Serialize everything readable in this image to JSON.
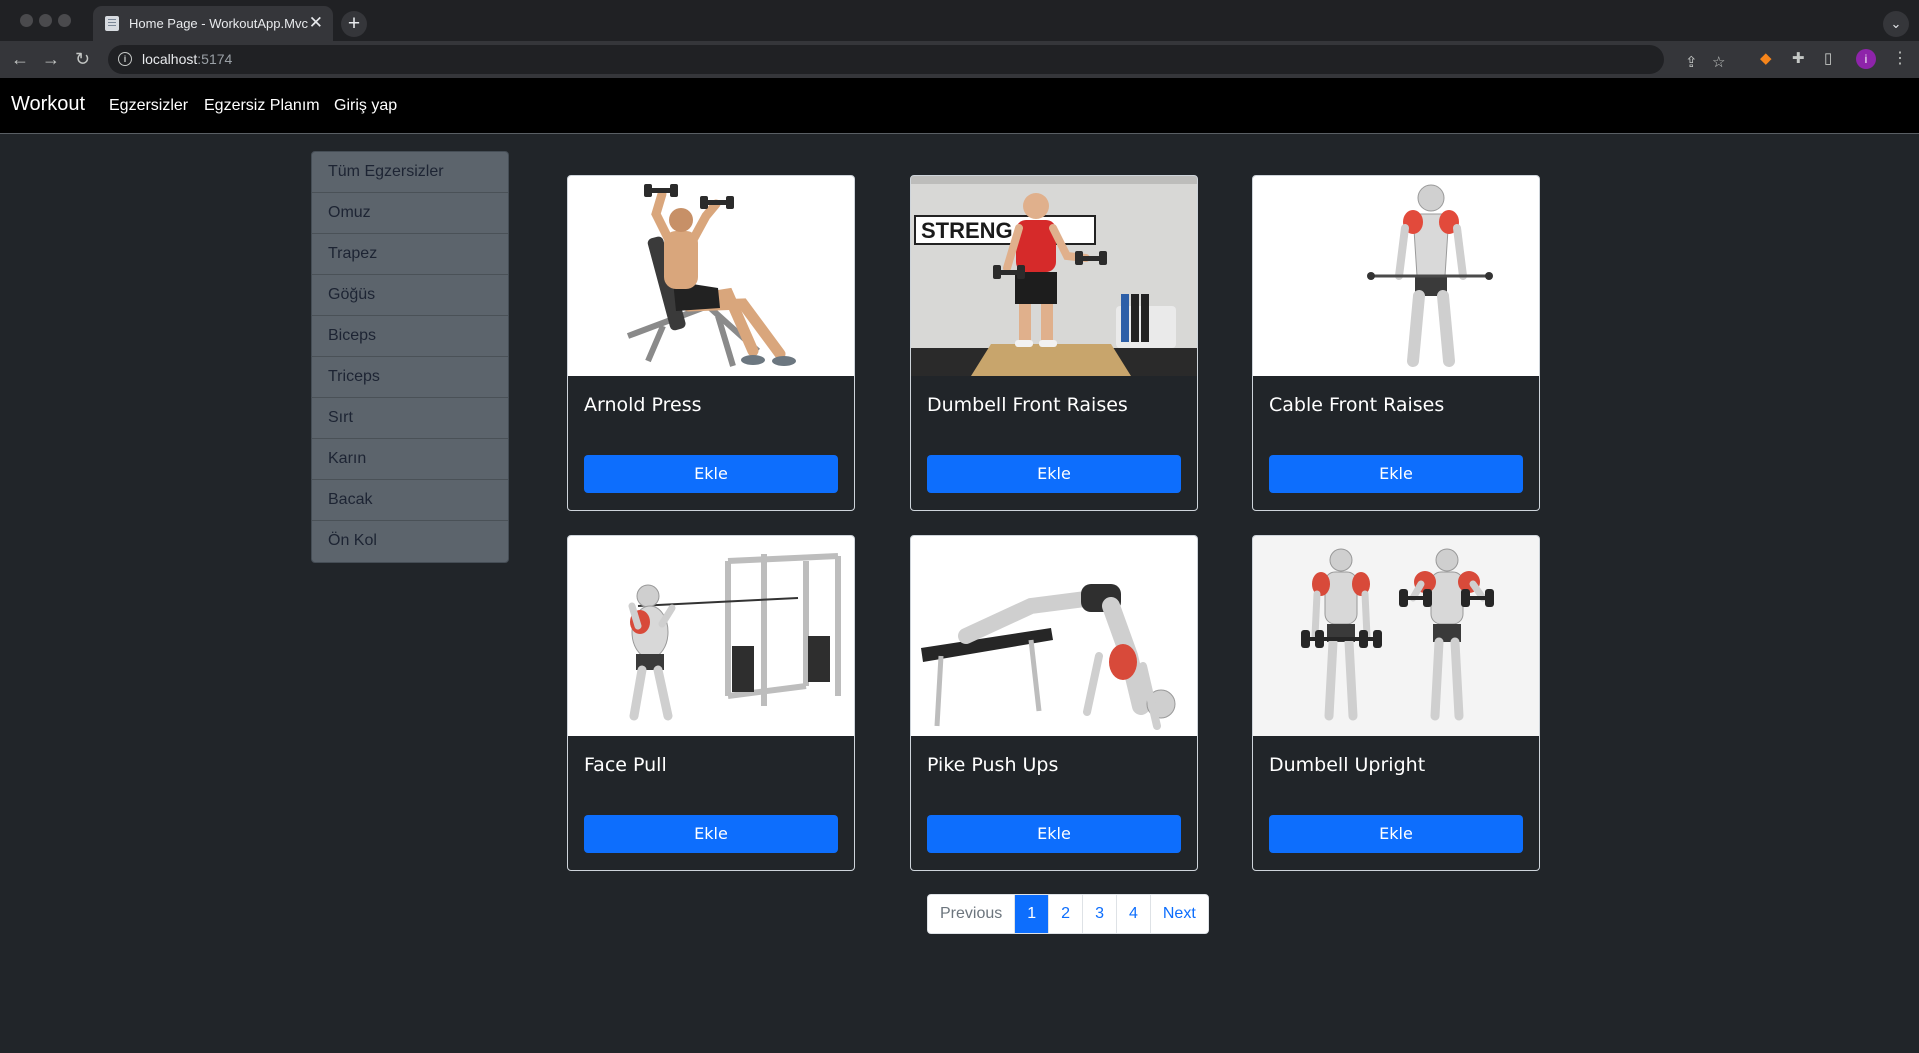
{
  "browser": {
    "tab_title": "Home Page - WorkoutApp.Mvc",
    "tab_close": "✕",
    "new_tab": "+",
    "url_host": "localhost",
    "url_port": ":5174",
    "icons": [
      "back-icon",
      "forward-icon",
      "reload-icon",
      "info-icon",
      "share-icon",
      "bookmark-star-icon",
      "metamask-extension-icon",
      "extensions-puzzle-icon",
      "side-panel-icon",
      "profile-avatar",
      "kebab-menu-icon"
    ],
    "profile_initial": "i"
  },
  "navbar": {
    "brand": "Workout",
    "links": [
      "Egzersizler",
      "Egzersiz Planım",
      "Giriş yap"
    ]
  },
  "sidebar": {
    "items": [
      "Tüm Egzersizler",
      "Omuz",
      "Trapez",
      "Göğüs",
      "Biceps",
      "Triceps",
      "Sırt",
      "Karın",
      "Bacak",
      "Ön Kol"
    ]
  },
  "cards": [
    {
      "title": "Arnold Press",
      "button": "Ekle",
      "image": "arnold-press-image"
    },
    {
      "title": "Dumbell Front Raises",
      "button": "Ekle",
      "image": "dumbell-front-raises-image"
    },
    {
      "title": "Cable Front Raises",
      "button": "Ekle",
      "image": "cable-front-raises-image"
    },
    {
      "title": "Face Pull",
      "button": "Ekle",
      "image": "face-pull-image"
    },
    {
      "title": "Pike Push Ups",
      "button": "Ekle",
      "image": "pike-push-ups-image"
    },
    {
      "title": "Dumbell Upright",
      "button": "Ekle",
      "image": "dumbell-upright-image"
    }
  ],
  "photo_text": {
    "gym_wall_sign": "STRENG"
  },
  "pagination": {
    "previous": "Previous",
    "pages": [
      "1",
      "2",
      "3",
      "4"
    ],
    "active_page": "1",
    "next": "Next"
  },
  "colors": {
    "page_bg": "#212529",
    "navbar_bg": "#000000",
    "primary": "#0d6efd",
    "sidebar_bg": "#5c646c"
  }
}
